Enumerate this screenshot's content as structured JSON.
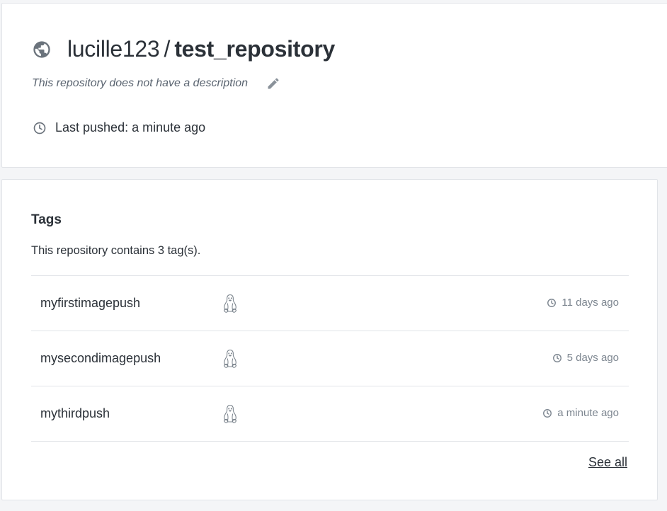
{
  "repository": {
    "owner": "lucille123",
    "separator": "/",
    "name": "test_repository",
    "description": "This repository does not have a description",
    "last_pushed": "Last pushed: a minute ago",
    "visibility_icon": "globe-icon",
    "edit_icon": "pencil-icon"
  },
  "tags": {
    "title": "Tags",
    "count_text": "This repository contains 3 tag(s).",
    "items": [
      {
        "name": "myfirstimagepush",
        "os_icon": "linux-icon",
        "time": "11 days ago"
      },
      {
        "name": "mysecondimagepush",
        "os_icon": "linux-icon",
        "time": "5 days ago"
      },
      {
        "name": "mythirdpush",
        "os_icon": "linux-icon",
        "time": "a minute ago"
      }
    ],
    "see_all_label": "See all"
  },
  "colors": {
    "text": "#2b3138",
    "muted": "#7d8690",
    "border": "#e1e4e8",
    "icon": "#6b737c"
  }
}
